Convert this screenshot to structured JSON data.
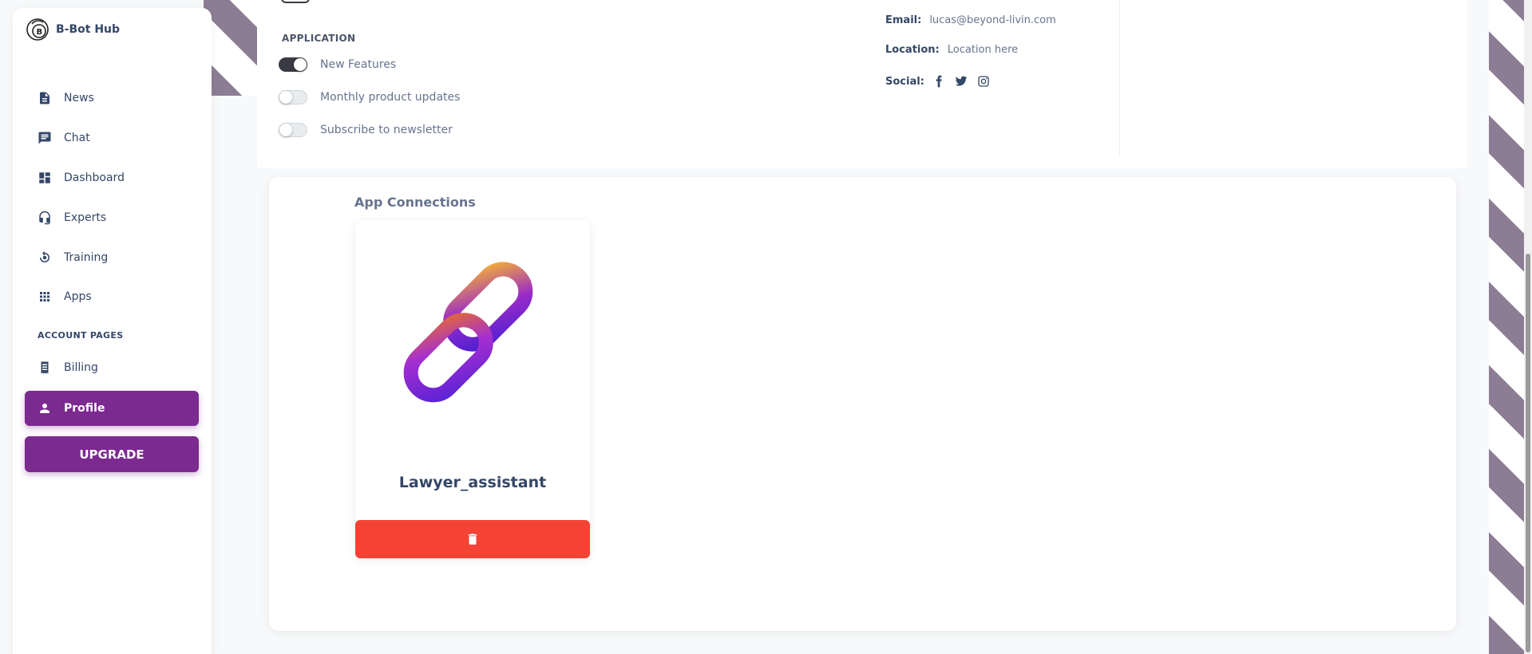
{
  "brand": {
    "name": "B-Bot Hub"
  },
  "sidebar": {
    "items": [
      {
        "label": "News",
        "icon": "news-icon"
      },
      {
        "label": "Chat",
        "icon": "chat-icon"
      },
      {
        "label": "Dashboard",
        "icon": "dashboard-icon"
      },
      {
        "label": "Experts",
        "icon": "headset-icon"
      },
      {
        "label": "Training",
        "icon": "training-icon"
      },
      {
        "label": "Apps",
        "icon": "apps-grid-icon"
      }
    ],
    "section_title": "ACCOUNT PAGES",
    "account_items": [
      {
        "label": "Billing",
        "icon": "receipt-icon"
      },
      {
        "label": "Profile",
        "icon": "person-icon",
        "active": true
      }
    ],
    "upgrade_label": "UPGRADE",
    "accent_color": "#7b2a8f"
  },
  "settings": {
    "section_label": "APPLICATION",
    "toggles": [
      {
        "label": "New Features",
        "on": true
      },
      {
        "label": "Monthly product updates",
        "on": false
      },
      {
        "label": "Subscribe to newsletter",
        "on": false
      }
    ]
  },
  "profile_info": {
    "email_key": "Email:",
    "email_val": "lucas@beyond-livin.com",
    "location_key": "Location:",
    "location_val": "Location here",
    "social_key": "Social:",
    "social_icons": [
      "facebook-icon",
      "twitter-icon",
      "instagram-icon"
    ]
  },
  "connections": {
    "title": "App Connections",
    "apps": [
      {
        "name": "Lawyer_assistant",
        "delete_color": "#f44335"
      }
    ]
  }
}
